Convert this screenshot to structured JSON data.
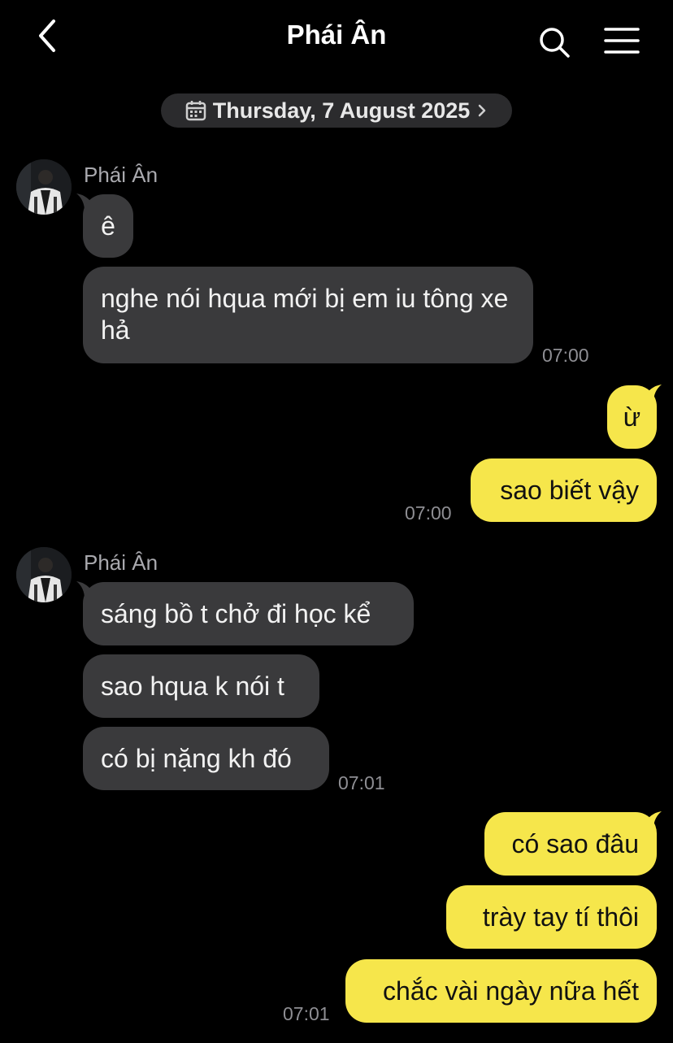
{
  "header": {
    "title": "Phái Ân"
  },
  "date_pill": {
    "label": "Thursday, 7 August 2025"
  },
  "groups": [
    {
      "sender": "Phái Ân",
      "messages": [
        "ê",
        "nghe nói hqua mới bị em iu tông xe hả"
      ],
      "time": "07:00"
    },
    {
      "sender": "me",
      "messages": [
        "ừ",
        "sao biết vậy"
      ],
      "time": "07:00"
    },
    {
      "sender": "Phái Ân",
      "messages": [
        "sáng bồ t chở đi học kể",
        "sao hqua k nói t",
        "có bị nặng kh đó"
      ],
      "time": "07:01"
    },
    {
      "sender": "me",
      "messages": [
        "có sao đâu",
        "trày tay tí thôi",
        "chắc vài ngày nữa hết"
      ],
      "time": "07:01"
    }
  ],
  "colors": {
    "background": "#000000",
    "incoming_bubble": "#3a3a3c",
    "outgoing_bubble": "#f6e64b",
    "timestamp": "#8e8e93"
  }
}
